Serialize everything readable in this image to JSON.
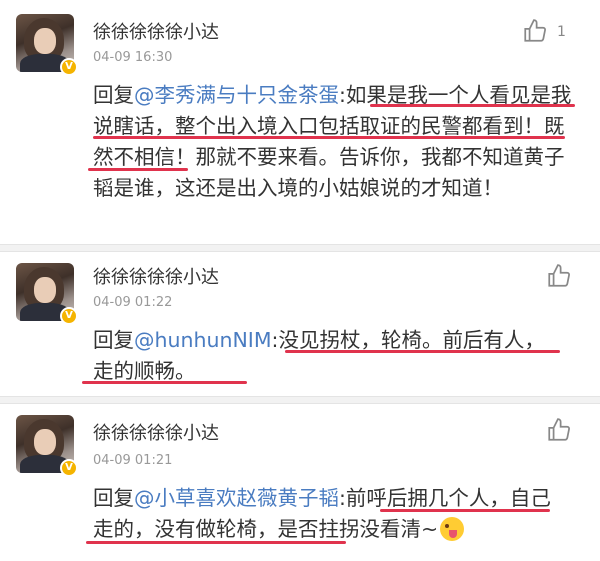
{
  "comments": [
    {
      "username": "徐徐徐徐徐小达",
      "timestamp": "04-09 16:30",
      "like_count": "1",
      "reply_prefix": "回复",
      "mention": "@李秀满与十只金茶蛋",
      "text": ":如果是我一个人看见是我说瞎话，整个出入境入口包括取证的民警都看到！既然不相信！那就不要来看。告诉你，我都不知道黄子韬是谁，这还是出入境的小姑娘说的才知道！"
    },
    {
      "username": "徐徐徐徐徐小达",
      "timestamp": "04-09 01:22",
      "like_count": "",
      "reply_prefix": "回复",
      "mention": "@hunhunNIM",
      "text": ":没见拐杖，轮椅。前后有人，走的顺畅。"
    },
    {
      "username": "徐徐徐徐徐小达",
      "timestamp": "04-09 01:21",
      "like_count": "",
      "reply_prefix": "回复",
      "mention": "@小草喜欢赵薇黄子韬",
      "text": ":前呼后拥几个人，自己走的，没有做轮椅，是否拄拐没看清~",
      "emoji": "tongue-out-emoji"
    }
  ],
  "colors": {
    "mention": "#4a7cc1",
    "underline": "#e0334d",
    "verified_badge": "#f5b400",
    "timestamp": "#999999"
  },
  "icons": {
    "like": "thumbs-up-icon",
    "verified": "verified-badge-icon"
  }
}
